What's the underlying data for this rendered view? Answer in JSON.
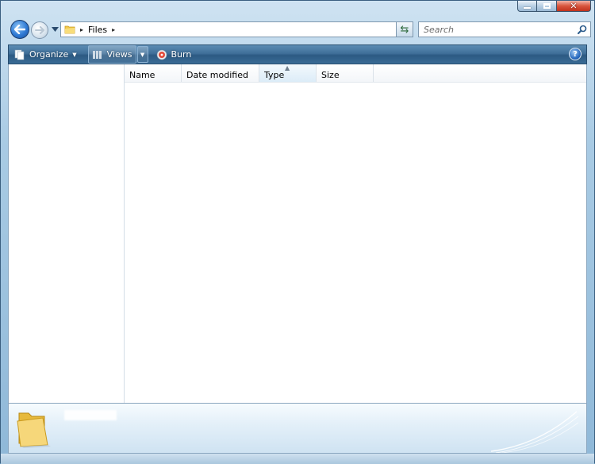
{
  "window": {
    "caption": {
      "minimize_icon": "minimize-icon",
      "maximize_icon": "maximize-icon",
      "close_icon": "close-icon",
      "close_glyph": "✕"
    }
  },
  "navigation": {
    "back_icon": "back-arrow-icon",
    "forward_icon": "forward-arrow-icon",
    "recent_icon": "chevron-down-icon"
  },
  "address": {
    "separator": "▸",
    "segment": "Files",
    "trailing_separator": "▸",
    "dropdown_glyph": "▼"
  },
  "refresh": {
    "glyph": "⇆"
  },
  "search": {
    "placeholder": "Search",
    "value": ""
  },
  "toolbar": {
    "organize_label": "Organize",
    "views_label": "Views",
    "burn_label": "Burn",
    "dropdown_glyph": "▼",
    "help_glyph": "?"
  },
  "columns": [
    {
      "label": "Name"
    },
    {
      "label": "Date modified"
    },
    {
      "label": "Type",
      "sorted": true
    },
    {
      "label": "Size"
    }
  ],
  "colors": {
    "command_bar": "#3f6f99",
    "accent": "#2f7ad4",
    "close_button": "#d8553d"
  }
}
